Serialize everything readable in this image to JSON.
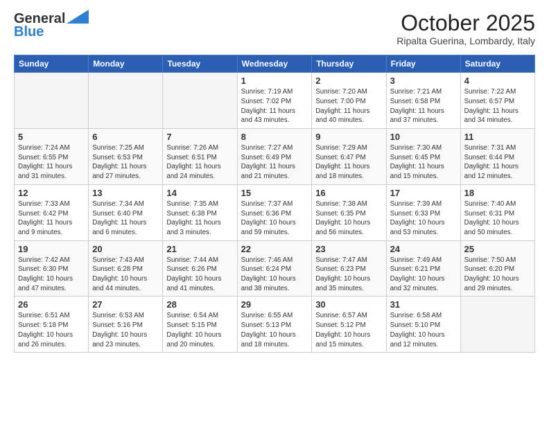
{
  "header": {
    "logo_general": "General",
    "logo_blue": "Blue",
    "month_title": "October 2025",
    "location": "Ripalta Guerina, Lombardy, Italy"
  },
  "days_of_week": [
    "Sunday",
    "Monday",
    "Tuesday",
    "Wednesday",
    "Thursday",
    "Friday",
    "Saturday"
  ],
  "weeks": [
    {
      "days": [
        {
          "number": "",
          "info": ""
        },
        {
          "number": "",
          "info": ""
        },
        {
          "number": "",
          "info": ""
        },
        {
          "number": "1",
          "info": "Sunrise: 7:19 AM\nSunset: 7:02 PM\nDaylight: 11 hours\nand 43 minutes."
        },
        {
          "number": "2",
          "info": "Sunrise: 7:20 AM\nSunset: 7:00 PM\nDaylight: 11 hours\nand 40 minutes."
        },
        {
          "number": "3",
          "info": "Sunrise: 7:21 AM\nSunset: 6:58 PM\nDaylight: 11 hours\nand 37 minutes."
        },
        {
          "number": "4",
          "info": "Sunrise: 7:22 AM\nSunset: 6:57 PM\nDaylight: 11 hours\nand 34 minutes."
        }
      ]
    },
    {
      "days": [
        {
          "number": "5",
          "info": "Sunrise: 7:24 AM\nSunset: 6:55 PM\nDaylight: 11 hours\nand 31 minutes."
        },
        {
          "number": "6",
          "info": "Sunrise: 7:25 AM\nSunset: 6:53 PM\nDaylight: 11 hours\nand 27 minutes."
        },
        {
          "number": "7",
          "info": "Sunrise: 7:26 AM\nSunset: 6:51 PM\nDaylight: 11 hours\nand 24 minutes."
        },
        {
          "number": "8",
          "info": "Sunrise: 7:27 AM\nSunset: 6:49 PM\nDaylight: 11 hours\nand 21 minutes."
        },
        {
          "number": "9",
          "info": "Sunrise: 7:29 AM\nSunset: 6:47 PM\nDaylight: 11 hours\nand 18 minutes."
        },
        {
          "number": "10",
          "info": "Sunrise: 7:30 AM\nSunset: 6:45 PM\nDaylight: 11 hours\nand 15 minutes."
        },
        {
          "number": "11",
          "info": "Sunrise: 7:31 AM\nSunset: 6:44 PM\nDaylight: 11 hours\nand 12 minutes."
        }
      ]
    },
    {
      "days": [
        {
          "number": "12",
          "info": "Sunrise: 7:33 AM\nSunset: 6:42 PM\nDaylight: 11 hours\nand 9 minutes."
        },
        {
          "number": "13",
          "info": "Sunrise: 7:34 AM\nSunset: 6:40 PM\nDaylight: 11 hours\nand 6 minutes."
        },
        {
          "number": "14",
          "info": "Sunrise: 7:35 AM\nSunset: 6:38 PM\nDaylight: 11 hours\nand 3 minutes."
        },
        {
          "number": "15",
          "info": "Sunrise: 7:37 AM\nSunset: 6:36 PM\nDaylight: 10 hours\nand 59 minutes."
        },
        {
          "number": "16",
          "info": "Sunrise: 7:38 AM\nSunset: 6:35 PM\nDaylight: 10 hours\nand 56 minutes."
        },
        {
          "number": "17",
          "info": "Sunrise: 7:39 AM\nSunset: 6:33 PM\nDaylight: 10 hours\nand 53 minutes."
        },
        {
          "number": "18",
          "info": "Sunrise: 7:40 AM\nSunset: 6:31 PM\nDaylight: 10 hours\nand 50 minutes."
        }
      ]
    },
    {
      "days": [
        {
          "number": "19",
          "info": "Sunrise: 7:42 AM\nSunset: 6:30 PM\nDaylight: 10 hours\nand 47 minutes."
        },
        {
          "number": "20",
          "info": "Sunrise: 7:43 AM\nSunset: 6:28 PM\nDaylight: 10 hours\nand 44 minutes."
        },
        {
          "number": "21",
          "info": "Sunrise: 7:44 AM\nSunset: 6:26 PM\nDaylight: 10 hours\nand 41 minutes."
        },
        {
          "number": "22",
          "info": "Sunrise: 7:46 AM\nSunset: 6:24 PM\nDaylight: 10 hours\nand 38 minutes."
        },
        {
          "number": "23",
          "info": "Sunrise: 7:47 AM\nSunset: 6:23 PM\nDaylight: 10 hours\nand 35 minutes."
        },
        {
          "number": "24",
          "info": "Sunrise: 7:49 AM\nSunset: 6:21 PM\nDaylight: 10 hours\nand 32 minutes."
        },
        {
          "number": "25",
          "info": "Sunrise: 7:50 AM\nSunset: 6:20 PM\nDaylight: 10 hours\nand 29 minutes."
        }
      ]
    },
    {
      "days": [
        {
          "number": "26",
          "info": "Sunrise: 6:51 AM\nSunset: 5:18 PM\nDaylight: 10 hours\nand 26 minutes."
        },
        {
          "number": "27",
          "info": "Sunrise: 6:53 AM\nSunset: 5:16 PM\nDaylight: 10 hours\nand 23 minutes."
        },
        {
          "number": "28",
          "info": "Sunrise: 6:54 AM\nSunset: 5:15 PM\nDaylight: 10 hours\nand 20 minutes."
        },
        {
          "number": "29",
          "info": "Sunrise: 6:55 AM\nSunset: 5:13 PM\nDaylight: 10 hours\nand 18 minutes."
        },
        {
          "number": "30",
          "info": "Sunrise: 6:57 AM\nSunset: 5:12 PM\nDaylight: 10 hours\nand 15 minutes."
        },
        {
          "number": "31",
          "info": "Sunrise: 6:58 AM\nSunset: 5:10 PM\nDaylight: 10 hours\nand 12 minutes."
        },
        {
          "number": "",
          "info": ""
        }
      ]
    }
  ]
}
